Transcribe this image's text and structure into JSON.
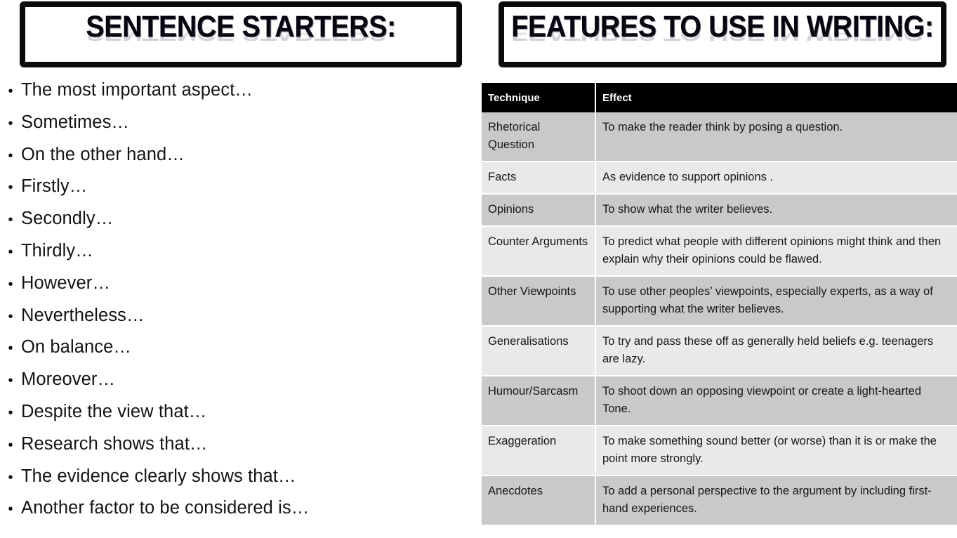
{
  "left_panel": {
    "title": "SENTENCE STARTERS:",
    "starters": [
      "The most important aspect…",
      "Sometimes…",
      "On the other hand…",
      "Firstly…",
      "Secondly…",
      "Thirdly…",
      "However…",
      "Nevertheless…",
      "On balance…",
      "Moreover…",
      "Despite the view that…",
      "Research shows that…",
      "The evidence clearly shows that…",
      "Another factor to be considered is…"
    ],
    "bullet_glyph": "•"
  },
  "right_panel": {
    "title": "FEATURES TO USE IN WRITING:",
    "table": {
      "columns": [
        "Technique",
        "Effect"
      ],
      "rows": [
        {
          "technique": "Rhetorical Question",
          "effect": "To make the reader think by posing a question."
        },
        {
          "technique": "Facts",
          "effect": "As evidence to support opinions ."
        },
        {
          "technique": "Opinions",
          "effect": "To show what the writer believes."
        },
        {
          "technique": "Counter Arguments",
          "effect": "To predict what people with different opinions might think and then explain why their opinions could be flawed."
        },
        {
          "technique": "Other Viewpoints",
          "effect": "To use other peoples’ viewpoints, especially experts, as a way of supporting what the writer believes."
        },
        {
          "technique": "Generalisations",
          "effect": "To try and pass these off as generally held beliefs e.g. teenagers are lazy."
        },
        {
          "technique": "Humour/Sarcasm",
          "effect": "To shoot down an opposing viewpoint or create a light-hearted Tone."
        },
        {
          "technique": "Exaggeration",
          "effect": "To make something sound better (or worse) than it is or make the point more strongly."
        },
        {
          "technique": "Anecdotes",
          "effect": "To add a personal perspective to the argument by including first-hand experiences."
        }
      ]
    }
  },
  "colors": {
    "page_background": "#ffffff",
    "border_black": "#0a0a0c",
    "table_header_background": "#000000",
    "table_header_text": "#ffffff",
    "row_shade_dark": "#c9c9c9",
    "row_shade_light": "#e9e9e9",
    "body_text": "#141414"
  }
}
